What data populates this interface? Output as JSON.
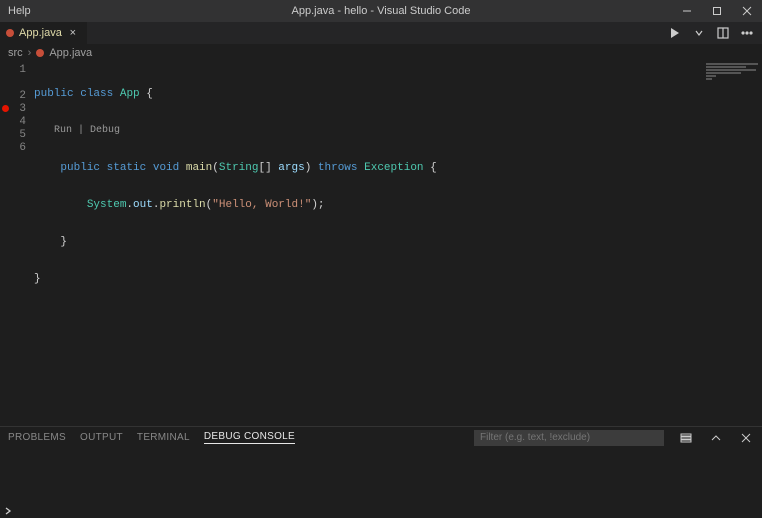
{
  "titlebar": {
    "menu_help": "Help",
    "title": "App.java - hello - Visual Studio Code"
  },
  "tab": {
    "filename": "App.java",
    "close": "×"
  },
  "breadcrumbs": {
    "seg1": "src",
    "seg2": "App.java",
    "sep": "›"
  },
  "codelens": {
    "text": "Run | Debug"
  },
  "gutter": [
    "1",
    "2",
    "3",
    "4",
    "5",
    "6"
  ],
  "code": {
    "l1": {
      "a": "public",
      "b": "class",
      "c": "App",
      "d": " {"
    },
    "l2": {
      "a": "public",
      "b": "static",
      "c": "void",
      "d": "main",
      "e": "(",
      "f": "String",
      "g": "[] ",
      "h": "args",
      "i": ") ",
      "j": "throws",
      "k": " ",
      "l": "Exception",
      "m": " {"
    },
    "l3": {
      "a": "System",
      "b": ".",
      "c": "out",
      "d": ".",
      "e": "println",
      "f": "(",
      "g": "\"Hello, World!\"",
      "h": ");"
    },
    "l4": {
      "a": "}"
    },
    "l5": {
      "a": "}"
    },
    "l6": {
      "a": ""
    }
  },
  "panel": {
    "problems": "PROBLEMS",
    "output": "OUTPUT",
    "terminal": "TERMINAL",
    "debug_console": "DEBUG CONSOLE",
    "filter_placeholder": "Filter (e.g. text, !exclude)"
  }
}
